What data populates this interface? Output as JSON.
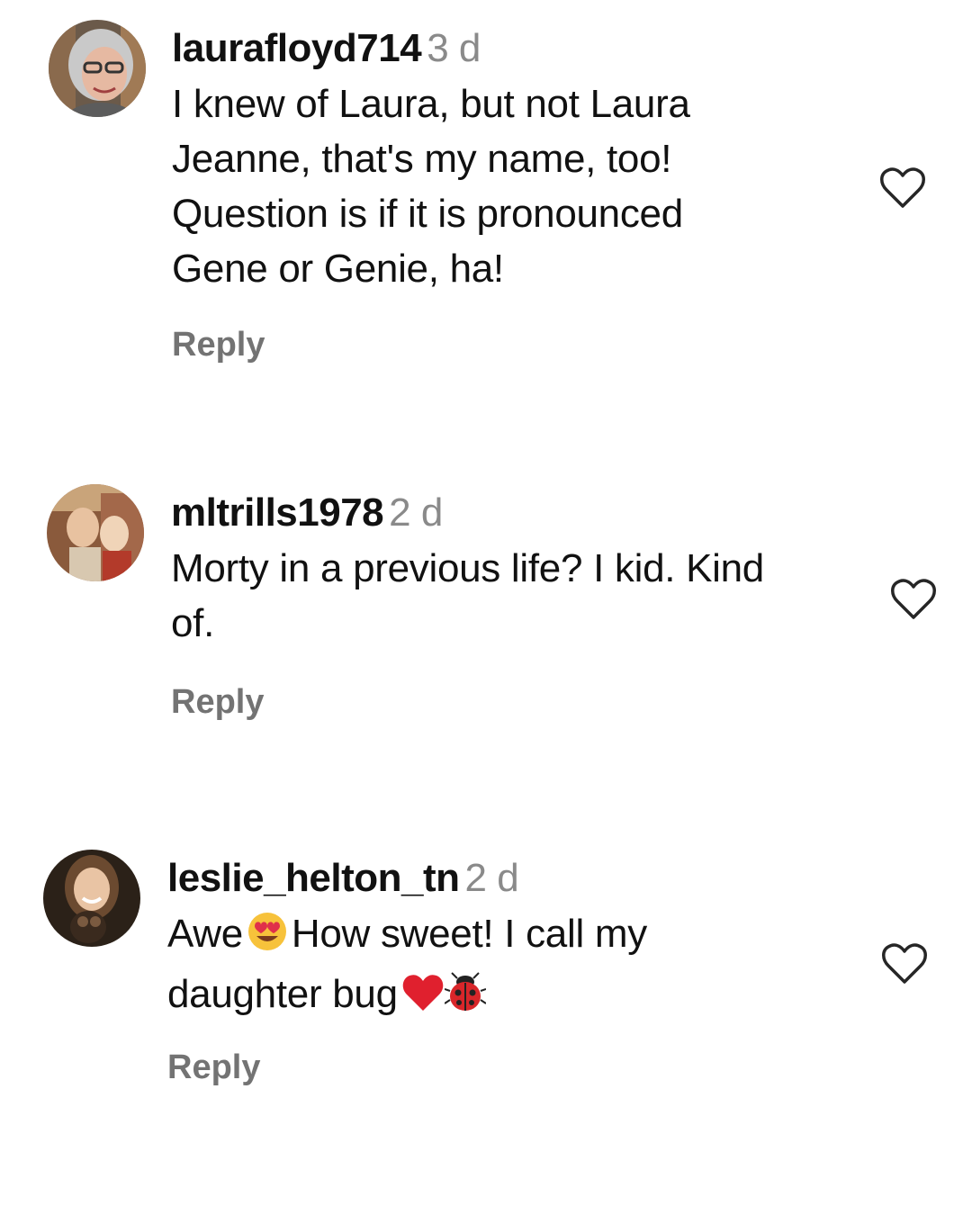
{
  "comments": [
    {
      "username": "laurafloyd714",
      "time": "3 d",
      "text": "I knew of Laura, but not Laura\nJeanne, that's my name, too!\nQuestion is if it is pronounced\nGene or Genie, ha!",
      "reply_label": "Reply",
      "avatar_icon": "profile-photo-woman-glasses",
      "like_icon": "heart-outline-icon"
    },
    {
      "username": "mltrills1978",
      "time": "2 d",
      "text": "Morty in a previous life? I kid. Kind\nof.",
      "reply_label": "Reply",
      "avatar_icon": "profile-photo-vintage",
      "like_icon": "heart-outline-icon"
    },
    {
      "username": "leslie_helton_tn",
      "time": "2 d",
      "text_part1": "Awe",
      "text_part2": "How sweet! I call my",
      "text_part3": "daughter bug",
      "emoji_1": "smiling-face-with-heart-eyes",
      "emoji_2": "red-heart",
      "emoji_3": "lady-beetle",
      "reply_label": "Reply",
      "avatar_icon": "profile-photo-woman-with-dog",
      "like_icon": "heart-outline-icon"
    }
  ],
  "colors": {
    "text": "#111111",
    "muted": "#8a8a8a",
    "reply": "#737373",
    "heart_stroke": "#262626"
  }
}
